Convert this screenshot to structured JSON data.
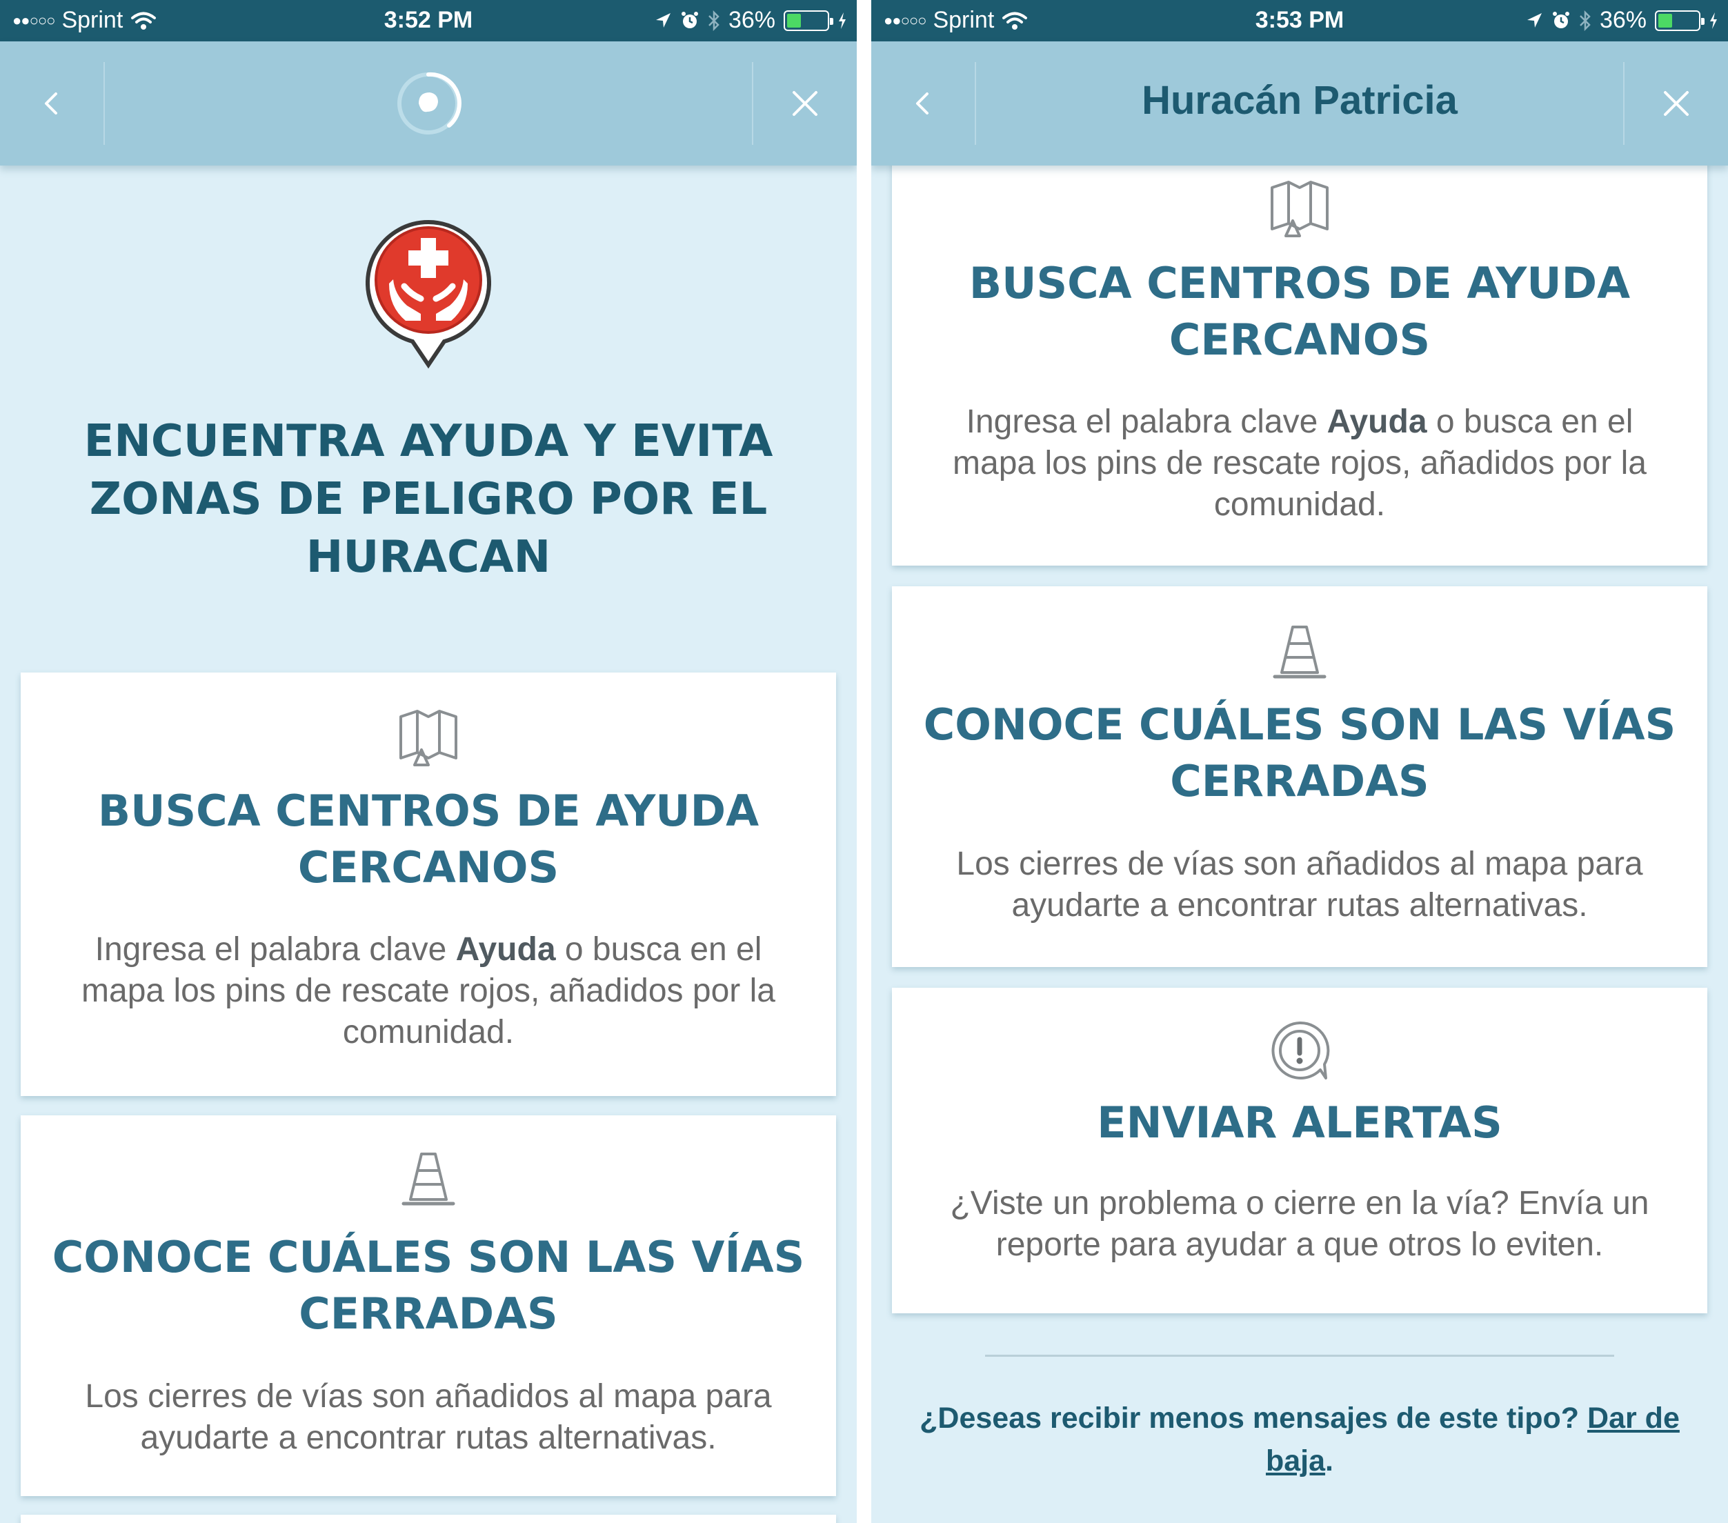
{
  "left_screen": {
    "status": {
      "carrier": "Sprint",
      "signal": "●●○○○",
      "time": "3:52 PM",
      "battery": "36%",
      "battery_level": 0.36
    },
    "nav": {
      "back_icon": "chevron-left-icon",
      "close_icon": "close-icon",
      "loading_icon": "spinner-icon"
    },
    "hero": {
      "icon": "medical-help-pin-icon",
      "title": "ENCUENTRA AYUDA Y EVITA ZONAS DE PELIGRO POR EL HURACAN"
    },
    "cards": [
      {
        "icon": "map-icon",
        "title": "BUSCA CENTROS DE AYUDA CERCANOS",
        "text_before": "Ingresa el palabra clave ",
        "keyword": "Ayuda",
        "text_after": " o busca en el mapa los pins de rescate rojos, añadidos por la comunidad."
      },
      {
        "icon": "traffic-cone-icon",
        "title": "CONOCE CUÁLES SON LAS VÍAS CERRADAS",
        "text": "Los cierres de vías son añadidos al mapa para ayudarte a encontrar rutas alternativas."
      }
    ]
  },
  "right_screen": {
    "status": {
      "carrier": "Sprint",
      "signal": "●●○○○",
      "time": "3:53 PM",
      "battery": "36%",
      "battery_level": 0.36
    },
    "nav": {
      "title": "Huracán Patricia",
      "back_icon": "chevron-left-icon",
      "close_icon": "close-icon"
    },
    "cards": [
      {
        "icon": "map-icon",
        "title": "BUSCA CENTROS DE AYUDA CERCANOS",
        "text_before": "Ingresa el palabra clave ",
        "keyword": "Ayuda",
        "text_after": " o busca en el mapa los pins de rescate rojos, añadidos por la comunidad."
      },
      {
        "icon": "traffic-cone-icon",
        "title": "CONOCE CUÁLES SON LAS VÍAS CERRADAS",
        "text": "Los cierres de vías son añadidos al mapa para ayudarte a encontrar rutas alternativas."
      },
      {
        "icon": "alert-icon",
        "title": "ENVIAR ALERTAS",
        "text": "¿Viste un problema o cierre en la vía? Envía un reporte para ayudar a que otros lo eviten."
      }
    ],
    "footer": {
      "question": "¿Deseas recibir menos mensajes de este tipo? ",
      "link": "Dar de baja",
      "end": "."
    }
  },
  "colors": {
    "status_bar": "#1c5b6f",
    "nav_bar": "#9ec9da",
    "background": "#ddeff7",
    "title_dark": "#1d5a70",
    "card_title": "#2e6d88",
    "body_text": "#6a6a6a",
    "pin_red": "#e03a2c",
    "battery_green": "#4cd964"
  }
}
